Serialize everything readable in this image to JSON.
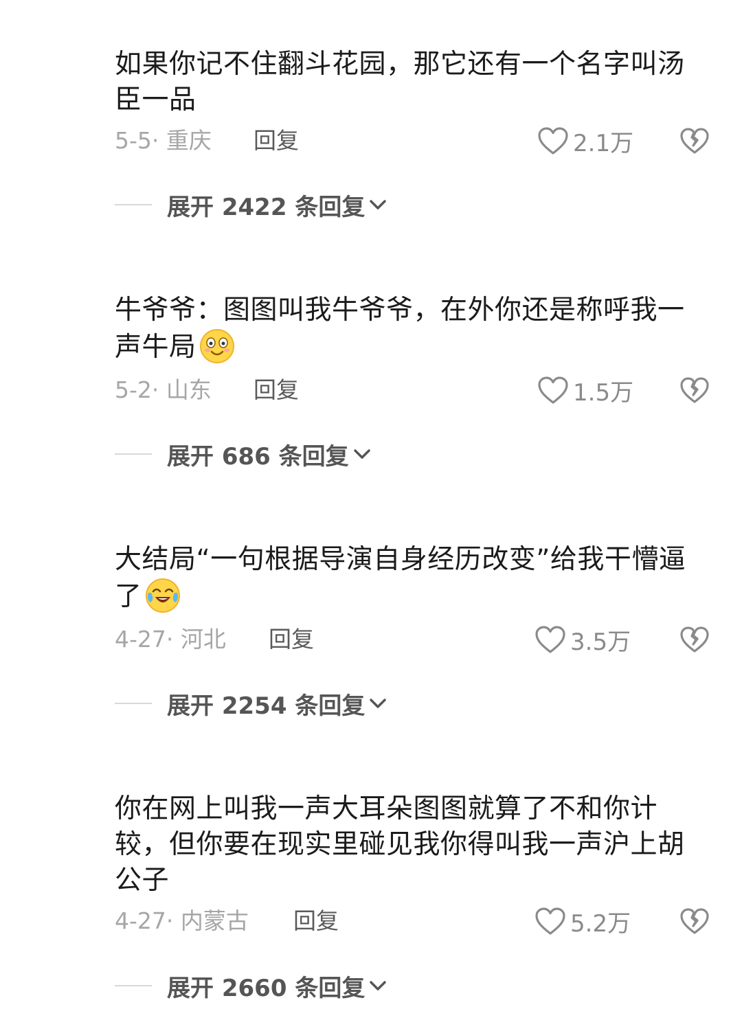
{
  "comments": [
    {
      "text": "如果你记不住翻斗花园，那它还有一个名字叫汤臣一品",
      "date": "5-5",
      "location": "重庆",
      "reply_label": "回复",
      "likes": "2.1万",
      "expand_prefix": "展开",
      "reply_count": "2422",
      "expand_suffix": "条回复"
    },
    {
      "text": "牛爷爷：图图叫我牛爷爷，在外你还是称呼我一声牛局",
      "emoji": "smile-emoji",
      "date": "5-2",
      "location": "山东",
      "reply_label": "回复",
      "likes": "1.5万",
      "expand_prefix": "展开",
      "reply_count": "686",
      "expand_suffix": "条回复"
    },
    {
      "text": "大结局“一句根据导演自身经历改变”给我干懵逼了",
      "emoji": "laugh-cry-emoji",
      "date": "4-27",
      "location": "河北",
      "reply_label": "回复",
      "likes": "3.5万",
      "expand_prefix": "展开",
      "reply_count": "2254",
      "expand_suffix": "条回复"
    },
    {
      "text": "你在网上叫我一声大耳朵图图就算了不和你计较，但你要在现实里碰见我你得叫我一声沪上胡公子",
      "date": "4-27",
      "location": "内蒙古",
      "reply_label": "回复",
      "likes": "5.2万",
      "expand_prefix": "展开",
      "reply_count": "2660",
      "expand_suffix": "条回复"
    }
  ],
  "colors": {
    "text": "#1b1b1b",
    "meta": "#a6a6a6",
    "reply": "#5a5a5a",
    "expand": "#555555"
  }
}
